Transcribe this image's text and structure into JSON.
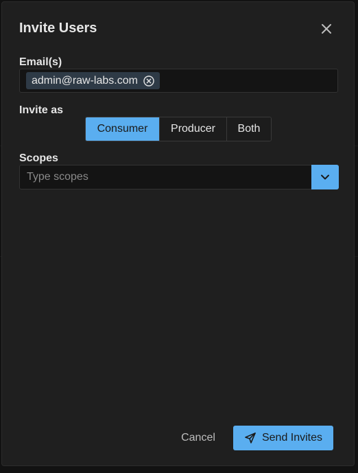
{
  "dialog": {
    "title": "Invite Users",
    "close_icon": "close-icon"
  },
  "emails": {
    "label": "Email(s)",
    "chips": [
      {
        "value": "admin@raw-labs.com",
        "remove_icon": "circle-x-icon"
      }
    ]
  },
  "invite_as": {
    "label": "Invite as",
    "options": [
      "Consumer",
      "Producer",
      "Both"
    ],
    "selected": "Consumer"
  },
  "scopes": {
    "label": "Scopes",
    "placeholder": "Type scopes",
    "value": "",
    "toggle_icon": "chevron-down-icon"
  },
  "footer": {
    "cancel_label": "Cancel",
    "send_label": "Send Invites",
    "send_icon": "paper-plane-icon"
  },
  "colors": {
    "accent": "#5aaef0",
    "background": "#1f1f1f",
    "chip": "#2e3a46"
  }
}
